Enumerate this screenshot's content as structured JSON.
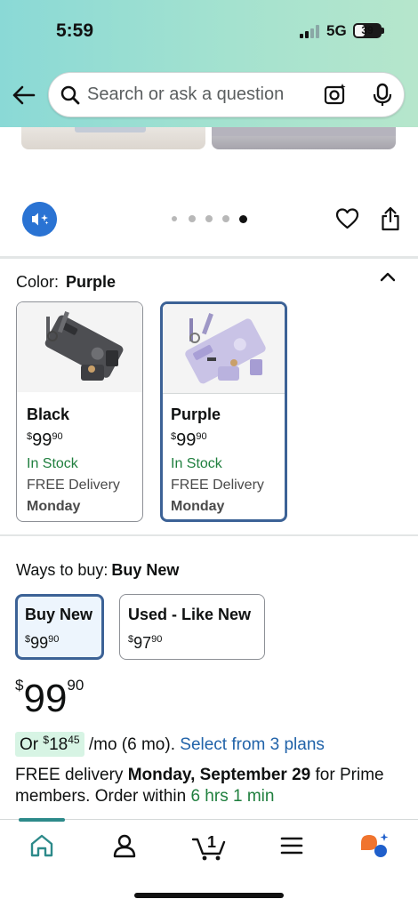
{
  "status_bar": {
    "time": "5:59",
    "network": "5G",
    "battery": "39",
    "battery_level": 0.39
  },
  "search": {
    "placeholder": "Search or ask a question"
  },
  "gallery": {
    "page_count": 5,
    "active_page": 5
  },
  "color_section": {
    "label": "Color:",
    "selected": "Purple",
    "options": [
      {
        "name": "Black",
        "currency": "$",
        "price_whole": "99",
        "price_fraction": "90",
        "stock": "In Stock",
        "delivery": "FREE Delivery",
        "day": "Monday",
        "selected": false
      },
      {
        "name": "Purple",
        "currency": "$",
        "price_whole": "99",
        "price_fraction": "90",
        "stock": "In Stock",
        "delivery": "FREE Delivery",
        "day": "Monday",
        "selected": true
      }
    ]
  },
  "ways_to_buy": {
    "label": "Ways to buy:",
    "selected": "Buy New",
    "options": [
      {
        "name": "Buy New",
        "currency": "$",
        "price_whole": "99",
        "price_fraction": "90",
        "selected": true
      },
      {
        "name": "Used - Like New",
        "currency": "$",
        "price_whole": "97",
        "price_fraction": "90",
        "selected": false
      }
    ]
  },
  "price": {
    "currency": "$",
    "whole": "99",
    "fraction": "90"
  },
  "monthly": {
    "prefix": "Or",
    "currency": "$",
    "whole": "18",
    "fraction": "45",
    "suffix": "/mo (6 mo).",
    "link": "Select from 3 plans"
  },
  "delivery_message": {
    "part1": "FREE delivery ",
    "date": "Monday, September 29",
    "part2": " for Prime members. Order within ",
    "countdown": "6 hrs 1 min"
  },
  "bottom_nav": {
    "cart_count": "1",
    "items": [
      "home",
      "account",
      "cart",
      "menu",
      "rufus"
    ]
  },
  "colors": {
    "header_gradient_start": "#8ad9d6",
    "selected_border": "#3c6296",
    "in_stock_green": "#1f7f3e",
    "link_blue": "#2163a9",
    "audio_button": "#2a73d3",
    "nav_active": "#2d8a8a",
    "rufus_orange": "#f0742e",
    "rufus_blue": "#1f5fcb"
  }
}
